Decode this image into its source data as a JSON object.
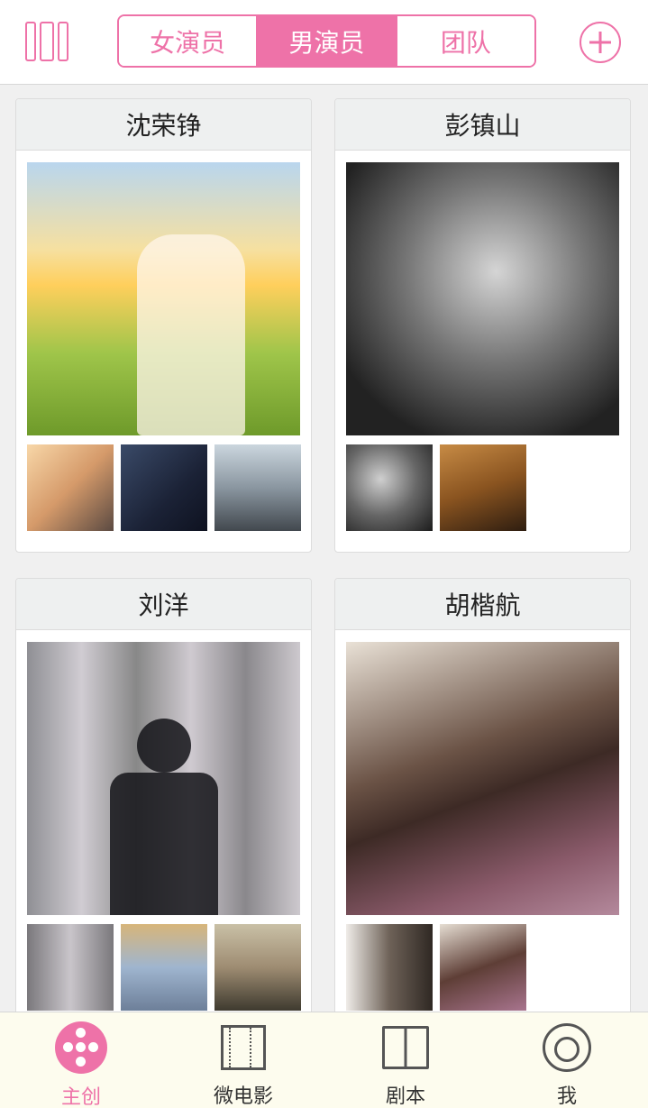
{
  "header": {
    "tabs": [
      {
        "label": "女演员",
        "active": false
      },
      {
        "label": "男演员",
        "active": true
      },
      {
        "label": "团队",
        "active": false
      }
    ],
    "menu_icon": "columns-menu-icon",
    "add_icon": "plus-circle-icon",
    "accent_color": "#ee72a8"
  },
  "cards": [
    {
      "name": "沈荣铮",
      "thumbnail_count": 3
    },
    {
      "name": "彭镇山",
      "thumbnail_count": 2
    },
    {
      "name": "刘洋",
      "thumbnail_count": 3
    },
    {
      "name": "胡楷航",
      "thumbnail_count": 2
    }
  ],
  "tabbar": {
    "items": [
      {
        "label": "主创",
        "icon": "film-reel-icon",
        "active": true
      },
      {
        "label": "微电影",
        "icon": "film-strip-icon",
        "active": false
      },
      {
        "label": "剧本",
        "icon": "book-icon",
        "active": false
      },
      {
        "label": "我",
        "icon": "user-icon",
        "active": false
      }
    ]
  }
}
